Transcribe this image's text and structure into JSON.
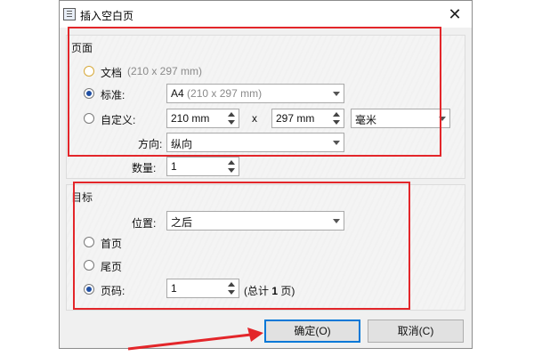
{
  "window": {
    "title": "插入空白页",
    "close_glyph": "✕"
  },
  "page_group": {
    "title": "页面",
    "document_label": "文档",
    "document_size": "(210 x 297 mm)",
    "standard_label": "标准:",
    "standard_value": "A4",
    "standard_size": "(210 x 297 mm)",
    "custom_label": "自定义:",
    "width_value": "210 mm",
    "times_sign": "x",
    "height_value": "297 mm",
    "unit_value": "毫米",
    "orientation_label": "方向:",
    "orientation_value": "纵向",
    "count_label": "数量:",
    "count_value": "1"
  },
  "target_group": {
    "title": "目标",
    "position_label": "位置:",
    "position_value": "之后",
    "first_page_label": "首页",
    "last_page_label": "尾页",
    "page_label": "页码:",
    "page_value": "1",
    "total_prefix": "(总计",
    "total_count": "1",
    "total_suffix": "页)"
  },
  "buttons": {
    "ok_label": "确定(O)",
    "cancel_label": "取消(C)"
  },
  "annotation_color": "#e3262a",
  "accent_color": "#0078d7"
}
